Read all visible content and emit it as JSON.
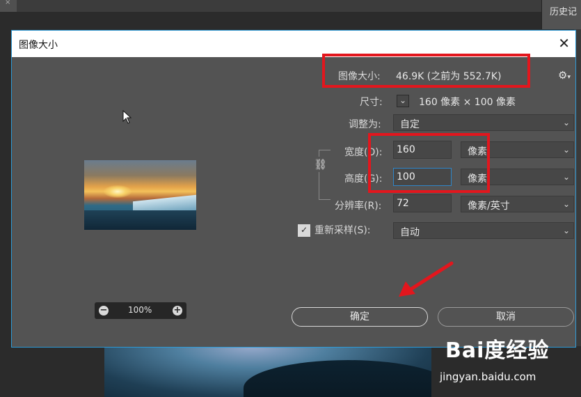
{
  "app": {
    "history_panel_label": "历史记"
  },
  "dialog": {
    "title": "图像大小",
    "close_glyph": "✕",
    "image_size": {
      "label": "图像大小:",
      "value": "46.9K (之前为 552.7K)"
    },
    "dimensions": {
      "label": "尺寸:",
      "value": "160 像素  ×  100 像素"
    },
    "fit_to": {
      "label": "调整为:",
      "selected": "自定"
    },
    "width": {
      "label": "宽度(D):",
      "value": "160",
      "unit": "像素"
    },
    "height": {
      "label": "高度(G):",
      "value": "100",
      "unit": "像素"
    },
    "resolution": {
      "label": "分辨率(R):",
      "value": "72",
      "unit": "像素/英寸"
    },
    "resample": {
      "label": "重新采样(S):",
      "checked": true,
      "selected": "自动"
    },
    "zoom": {
      "value": "100%"
    },
    "ok_label": "确定",
    "cancel_label": "取消"
  },
  "watermark": {
    "brand": "Bai度经验",
    "site": "jingyan.baidu.com"
  },
  "colors": {
    "dialog_bg": "#535353",
    "accent_border": "#2e9ad6",
    "highlight": "#e3161d"
  }
}
